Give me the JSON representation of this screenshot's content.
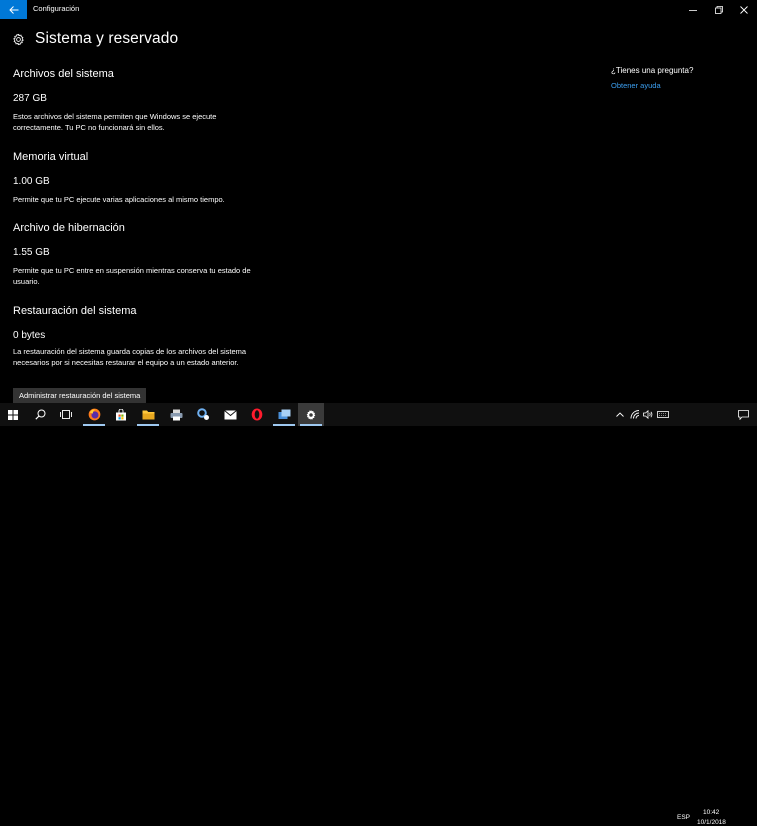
{
  "window": {
    "title": "Configuración"
  },
  "page": {
    "title": "Sistema y reservado"
  },
  "sections": [
    {
      "title": "Archivos del sistema",
      "size": "287 GB",
      "description": "Estos archivos del sistema permiten que Windows se ejecute correctamente. Tu PC no funcionará sin ellos."
    },
    {
      "title": "Memoria virtual",
      "size": "1.00 GB",
      "description": "Permite que tu PC ejecute varias aplicaciones al mismo tiempo."
    },
    {
      "title": "Archivo de hibernación",
      "size": "1.55 GB",
      "description": "Permite que tu PC entre en suspensión mientras conserva tu estado de usuario."
    },
    {
      "title": "Restauración del sistema",
      "size": "0 bytes",
      "description": "La restauración del sistema guarda copias de los archivos del sistema necesarios por si necesitas restaurar el equipo a un estado anterior."
    }
  ],
  "manage_button": {
    "label": "Administrar restauración del sistema"
  },
  "help": {
    "question": "¿Tienes una pregunta?",
    "link": "Obtener ayuda"
  },
  "taskbar": {
    "apps": [
      "start-icon",
      "search-icon",
      "task-view-icon",
      "firefox-icon",
      "store-icon",
      "file-explorer-icon",
      "printer-icon",
      "network-settings-icon",
      "mail-icon",
      "opera-icon",
      "remote-desktop-icon",
      "settings-icon"
    ],
    "language": "ESP",
    "time": "10:42",
    "date": "10/1/2018"
  },
  "colors": {
    "accent": "#0078d7",
    "link": "#3c9ff0",
    "background": "#000000",
    "button": "#333333"
  }
}
